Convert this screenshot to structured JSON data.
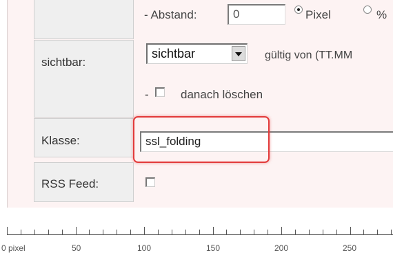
{
  "abstand": {
    "label": "- Abstand:",
    "value": "0",
    "unit_pixel": "Pixel",
    "unit_percent": "%"
  },
  "sichtbar": {
    "label": "sichtbar:",
    "select_value": "sichtbar",
    "valid_from": "gültig von (TT.MM",
    "delete_prefix": "-",
    "delete_label": "danach löschen"
  },
  "klasse": {
    "label": "Klasse:",
    "value": "ssl_folding"
  },
  "rss": {
    "label": "RSS Feed:"
  },
  "ruler": {
    "labels": [
      "0 pixel",
      "50",
      "100",
      "150",
      "200",
      "250"
    ]
  }
}
